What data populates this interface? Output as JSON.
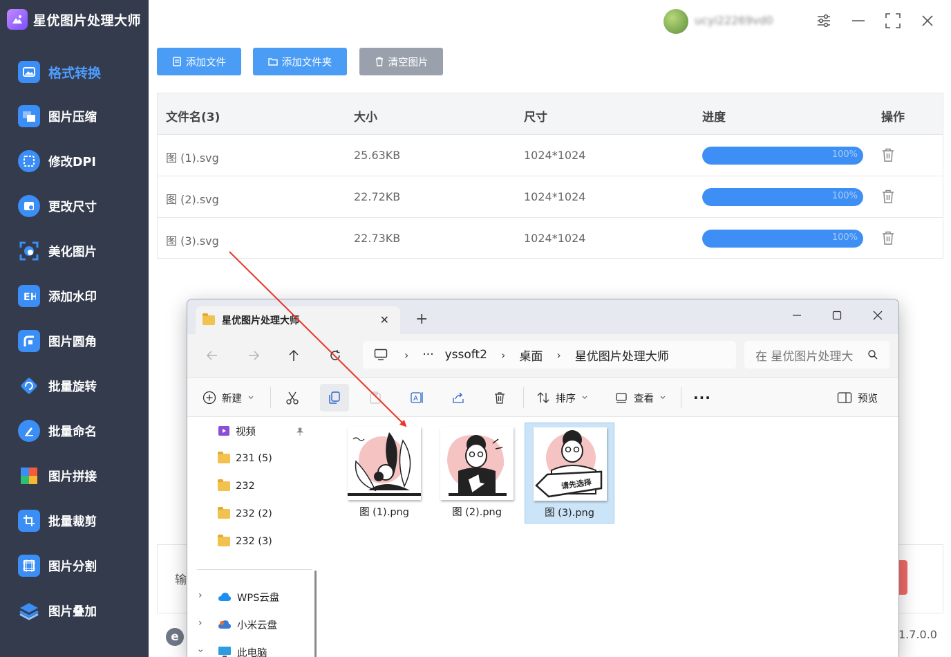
{
  "app": {
    "title": "星优图片处理大师",
    "version": "1.7.0.0",
    "user_name": "ucyi22269vd0",
    "output_label": "输"
  },
  "sidebar": {
    "items": [
      {
        "label": "格式转换",
        "icon": "format-convert-icon",
        "color": "#3a8ef6"
      },
      {
        "label": "图片压缩",
        "icon": "image-compress-icon",
        "color": "#3a8ef6"
      },
      {
        "label": "修改DPI",
        "icon": "dpi-icon",
        "color": "#3a8ef6"
      },
      {
        "label": "更改尺寸",
        "icon": "resize-icon",
        "color": "#3a8ef6"
      },
      {
        "label": "美化图片",
        "icon": "beautify-icon",
        "color": "#3a8ef6"
      },
      {
        "label": "添加水印",
        "icon": "watermark-icon",
        "color": "#3a8ef6"
      },
      {
        "label": "图片圆角",
        "icon": "round-corner-icon",
        "color": "#3a8ef6"
      },
      {
        "label": "批量旋转",
        "icon": "rotate-icon",
        "color": "#3a8ef6"
      },
      {
        "label": "批量命名",
        "icon": "rename-icon",
        "color": "#3a8ef6"
      },
      {
        "label": "图片拼接",
        "icon": "puzzle-icon",
        "color": "#3a8ef6"
      },
      {
        "label": "批量裁剪",
        "icon": "crop-icon",
        "color": "#3a8ef6"
      },
      {
        "label": "图片分割",
        "icon": "split-icon",
        "color": "#3a8ef6"
      },
      {
        "label": "图片叠加",
        "icon": "layers-icon",
        "color": "#3a8ef6"
      }
    ],
    "active_index": 0
  },
  "toolbar": {
    "add_file": "添加文件",
    "add_folder": "添加文件夹",
    "clear_images": "清空图片"
  },
  "file_table": {
    "headers": {
      "name": "文件名(3)",
      "size": "大小",
      "dims": "尺寸",
      "progress": "进度",
      "action": "操作"
    },
    "rows": [
      {
        "name": "图 (1).svg",
        "size": "25.63KB",
        "dims": "1024*1024",
        "progress": 1.0,
        "progress_text": "100%"
      },
      {
        "name": "图 (2).svg",
        "size": "22.72KB",
        "dims": "1024*1024",
        "progress": 1.0,
        "progress_text": "100%"
      },
      {
        "name": "图 (3).svg",
        "size": "22.73KB",
        "dims": "1024*1024",
        "progress": 1.0,
        "progress_text": "100%"
      }
    ]
  },
  "explorer": {
    "tab_title": "星优图片处理大师",
    "breadcrumb": [
      "yssoft2",
      "桌面",
      "星优图片处理大师"
    ],
    "search_placeholder": "在 星优图片处理大",
    "commands": {
      "new": "新建",
      "sort": "排序",
      "view": "查看",
      "preview": "预览"
    },
    "nav_items": [
      {
        "label": "视频",
        "type": "video"
      },
      {
        "label": "231 (5)",
        "type": "folder"
      },
      {
        "label": "232",
        "type": "folder"
      },
      {
        "label": "232 (2)",
        "type": "folder"
      },
      {
        "label": "232 (3)",
        "type": "folder"
      },
      {
        "label": "WPS云盘",
        "type": "cloud"
      },
      {
        "label": "小米云盘",
        "type": "cloud"
      },
      {
        "label": "此电脑",
        "type": "pc"
      }
    ],
    "files": [
      {
        "label": "图 (1).png",
        "selected": false
      },
      {
        "label": "图 (2).png",
        "selected": false
      },
      {
        "label": "图 (3).png",
        "selected": true,
        "banner_text": "请先选择"
      }
    ]
  },
  "colors": {
    "accent": "#4a9cf5",
    "sidebar_bg": "#343b4d",
    "progress": "#3d8ff5",
    "annotation_arrow": "#e8362c"
  }
}
